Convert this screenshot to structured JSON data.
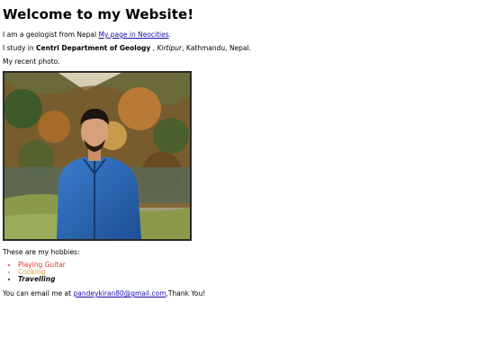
{
  "heading": "Welcome to my Website!",
  "intro": {
    "text": "I am a geologist from Nepal ",
    "link": "My page in Neocities",
    "after": "."
  },
  "study": {
    "prefix": "I study in ",
    "department": "Centrl Department of Geology",
    "sep": " , ",
    "place": "Kirtipur",
    "suffix": ", Kathmandu, Nepal."
  },
  "photo_caption": "My recent photo.",
  "hobbies_intro": "These are my hobbies:",
  "hobbies": [
    "Playing Guitar",
    "Cooking",
    "Travelling"
  ],
  "contact": {
    "prefix": "You can email me at ",
    "email": "pandeykiran80@gmail.com",
    "suffix": ",Thank You!"
  },
  "colors": {
    "link": "#1a0dab",
    "hobby_1": "#e8332a",
    "hobby_2": "#e8a23a"
  }
}
